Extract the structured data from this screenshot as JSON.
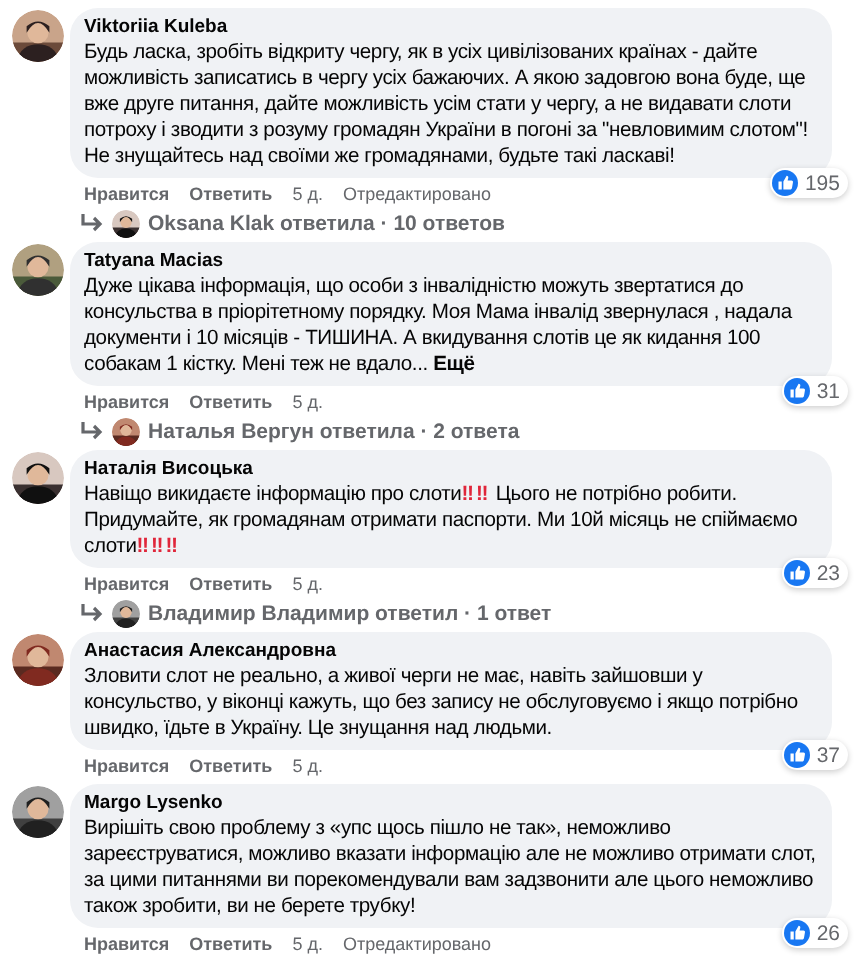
{
  "comments": [
    {
      "author": "Viktoriia Kuleba",
      "segments": [
        {
          "kind": "text",
          "text": "Будь ласка, зробіть відкриту чергу, як в усіх цивілізованих країнах - дайте можливість записатись в чергу усіх бажаючих. А якою задовгою вона буде, ще вже друге питання, дайте можливість усім стати у чергу, а не видавати слоти потроху і зводити з розуму громадян України в погоні за \"невловимим слотом\"! Не знущайтесь над своїми же громадянами, будьте такі ласкаві!"
        }
      ],
      "like": "Нравится",
      "reply": "Ответить",
      "time": "5 д.",
      "edited": "Отредактировано",
      "likes": "195",
      "replies": "Oksana Klak ответила · 10 ответов"
    },
    {
      "author": "Tatyana Macias",
      "segments": [
        {
          "kind": "text",
          "text": "Дуже цікава інформація, що особи з інвалідністю можуть звертатися до консульства в пріорітетному порядку. Моя Мама інвалід звернулася , надала документи і 10 місяців - ТИШИНА. А вкидування слотів це як кидання 100 собакам 1 кістку. Мені теж не вдало..."
        }
      ],
      "more": "Ещё",
      "like": "Нравится",
      "reply": "Ответить",
      "time": "5 д.",
      "likes": "31",
      "replies": "Наталья Вергун ответила · 2 ответа"
    },
    {
      "author": "Наталія Висоцька",
      "segments": [
        {
          "kind": "text",
          "text": "Навіщо викидаєте інформацію про слоти"
        },
        {
          "kind": "emoji",
          "text": "‼‼"
        },
        {
          "kind": "text",
          "text": " Цього не потрібно робити. Придумайте, як громадянам отримати паспорти. Ми 10й місяць не спіймаємо слоти"
        },
        {
          "kind": "emoji",
          "text": "‼‼‼"
        }
      ],
      "like": "Нравится",
      "reply": "Ответить",
      "time": "5 д.",
      "likes": "23",
      "replies": "Владимир Владимир ответил · 1 ответ"
    },
    {
      "author": "Анастасия Александровна",
      "segments": [
        {
          "kind": "text",
          "text": "Зловити слот не реально, а живої черги не має, навіть зайшовши у консульство, у віконці кажуть, що без запису не обслуговуємо і якщо потрібно швидко, їдьте в Україну. Це знущання над людьми."
        }
      ],
      "like": "Нравится",
      "reply": "Ответить",
      "time": "5 д.",
      "likes": "37"
    },
    {
      "author": "Margo Lysenko",
      "segments": [
        {
          "kind": "text",
          "text": "Вирішіть свою проблему з «упс щось пішло не так», неможливо зареєструватися, можливо вказати інформацію але не можливо отримати слот, за цими питаннями ви порекомендували вам задзвонити але цього неможливо також зробити, ви не берете трубку!"
        }
      ],
      "like": "Нравится",
      "reply": "Ответить",
      "time": "5 д.",
      "edited": "Отредактировано",
      "likes": "26"
    }
  ]
}
